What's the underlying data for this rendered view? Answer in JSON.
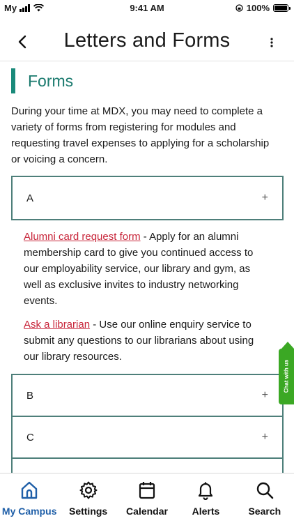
{
  "status_bar": {
    "carrier": "My",
    "time": "9:41 AM",
    "battery": "100%"
  },
  "header": {
    "title": "Letters and Forms"
  },
  "section": {
    "title": "Forms",
    "intro": "During your time at MDX, you may need to complete a variety of forms from registering for modules and requesting travel expenses to applying for a scholarship or voicing a concern."
  },
  "accordions": [
    {
      "label": "A",
      "icon": "+"
    },
    {
      "label": "B",
      "icon": "+"
    },
    {
      "label": "C",
      "icon": "+"
    }
  ],
  "forms": [
    {
      "link": "Alumni card request form",
      "desc": " - Apply for an alumni membership card to give you continued access to our employability service, our library and gym, as well as exclusive invites to industry networking events."
    },
    {
      "link": "Ask a librarian",
      "desc": " - Use our online enquiry service to submit any questions to our librarians about using our library resources."
    }
  ],
  "chat": {
    "label": "Chat with us"
  },
  "tabs": [
    {
      "label": "My Campus",
      "icon": "home-icon"
    },
    {
      "label": "Settings",
      "icon": "gear-icon"
    },
    {
      "label": "Calendar",
      "icon": "calendar-icon"
    },
    {
      "label": "Alerts",
      "icon": "bell-icon"
    },
    {
      "label": "Search",
      "icon": "search-icon"
    }
  ],
  "colors": {
    "accent": "#1a8a7a",
    "link": "#c8253a",
    "active_tab": "#1f5fa8",
    "chat": "#3ba824"
  }
}
